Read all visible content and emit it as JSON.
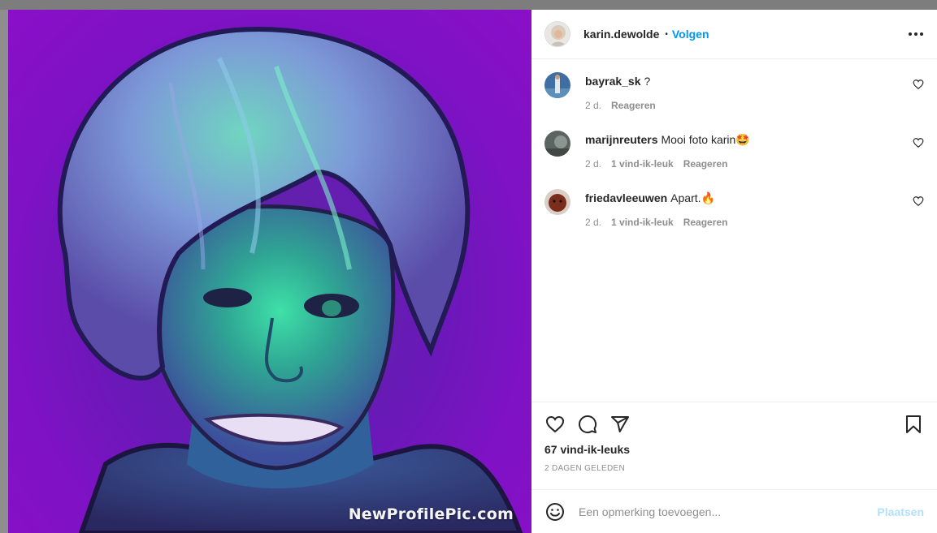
{
  "post": {
    "author": "karin.dewolde",
    "follow_label": "Volgen",
    "separator": "•",
    "watermark": "NewProfilePic.com"
  },
  "comments": [
    {
      "username": "bayrak_sk",
      "text": "?",
      "time": "2 d.",
      "likes": "",
      "reply": "Reageren"
    },
    {
      "username": "marijnreuters",
      "text": "Mooi foto karin🤩",
      "time": "2 d.",
      "likes": "1 vind-ik-leuk",
      "reply": "Reageren"
    },
    {
      "username": "friedavleeuwen",
      "text": "Apart.🔥",
      "time": "2 d.",
      "likes": "1 vind-ik-leuk",
      "reply": "Reageren"
    }
  ],
  "engagement": {
    "likes_count": "67 vind-ik-leuks",
    "posted": "2 DAGEN GELEDEN"
  },
  "composer": {
    "placeholder": "Een opmerking toevoegen...",
    "submit_label": "Plaatsen"
  },
  "icons": {
    "more": "more-horizontal-icon",
    "like": "heart-icon",
    "comment": "comment-bubble-icon",
    "share": "paper-plane-icon",
    "save": "bookmark-icon",
    "emoji": "smiley-icon"
  },
  "colors": {
    "link_blue": "#0095f6",
    "disabled_blue": "#b2dffc",
    "muted_text": "#8e8e8e",
    "image_background": "#7e12c4"
  }
}
